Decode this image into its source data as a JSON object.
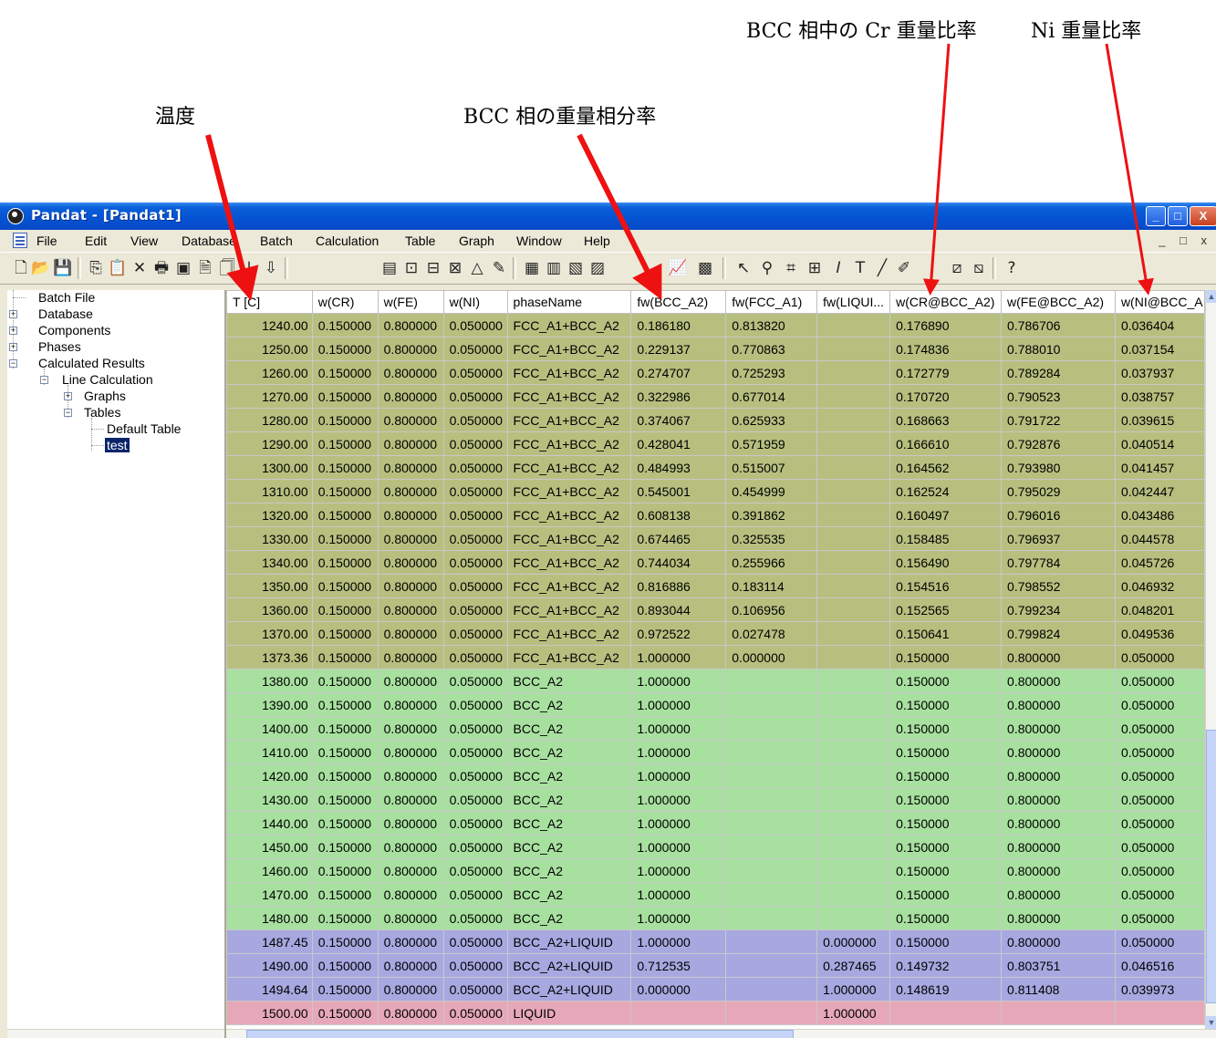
{
  "annotations": {
    "temperature": "温度",
    "bcc_fraction": "BCC 相の重量相分率",
    "cr_in_bcc": "BCC 相中の Cr 重量比率",
    "ni_ratio": "Ni 重量比率",
    "arrow_color": "#ee1111"
  },
  "window": {
    "title": "Pandat - [Pandat1]",
    "controls": {
      "minimize": "_",
      "maximize": "□",
      "close": "X"
    }
  },
  "menubar": {
    "items": [
      "File",
      "Edit",
      "View",
      "Database",
      "Batch",
      "Calculation",
      "Table",
      "Graph",
      "Window",
      "Help"
    ],
    "mdi_controls": "_ □ x"
  },
  "toolbar": {
    "icons": [
      "new-icon",
      "open-icon",
      "save-icon",
      "copy-icon",
      "paste-icon",
      "delete-icon",
      "print-icon",
      "batch-icon",
      "page-icon",
      "page-icon-2",
      "arrow-down-icon",
      "import-icon",
      "table-icon",
      "point-icon",
      "line-icon",
      "envelope-icon",
      "triangle-icon",
      "paint-icon",
      "grid-icon",
      "calc-table-icon",
      "chart-table-icon",
      "chart-table-icon-2",
      "line-chart-icon",
      "excel-icon",
      "pointer-icon",
      "pick-icon",
      "zoom-icon",
      "grid-select-icon",
      "italic-text-icon",
      "text-icon",
      "draw-line-icon",
      "pen-icon",
      "chart-zoom-icon",
      "chart-zoom-icon-2",
      "help-icon"
    ]
  },
  "tree": {
    "batch_file": "Batch File",
    "database": "Database",
    "components": "Components",
    "phases": "Phases",
    "calculated_results": "Calculated Results",
    "line_calculation": "Line Calculation",
    "graphs": "Graphs",
    "tables": "Tables",
    "default_table": "Default Table",
    "test": "test",
    "collapsed_sign": "+",
    "expanded_sign": "−"
  },
  "grid": {
    "columns": [
      "T [C]",
      "w(CR)",
      "w(FE)",
      "w(NI)",
      "phaseName",
      "fw(BCC_A2)",
      "fw(FCC_A1)",
      "fw(LIQUI...",
      "w(CR@BCC_A2)",
      "w(FE@BCC_A2)",
      "w(NI@BCC_A"
    ],
    "phase_colors": {
      "FCC_A1+BCC_A2": "#b7bf7f",
      "BCC_A2": "#a8e0a0",
      "BCC_A2+LIQUID": "#a7a8e0",
      "LIQUID": "#e6a8b8"
    },
    "rows": [
      [
        "1240.00",
        "0.150000",
        "0.800000",
        "0.050000",
        "FCC_A1+BCC_A2",
        "0.186180",
        "0.813820",
        "",
        "0.176890",
        "0.786706",
        "0.036404"
      ],
      [
        "1250.00",
        "0.150000",
        "0.800000",
        "0.050000",
        "FCC_A1+BCC_A2",
        "0.229137",
        "0.770863",
        "",
        "0.174836",
        "0.788010",
        "0.037154"
      ],
      [
        "1260.00",
        "0.150000",
        "0.800000",
        "0.050000",
        "FCC_A1+BCC_A2",
        "0.274707",
        "0.725293",
        "",
        "0.172779",
        "0.789284",
        "0.037937"
      ],
      [
        "1270.00",
        "0.150000",
        "0.800000",
        "0.050000",
        "FCC_A1+BCC_A2",
        "0.322986",
        "0.677014",
        "",
        "0.170720",
        "0.790523",
        "0.038757"
      ],
      [
        "1280.00",
        "0.150000",
        "0.800000",
        "0.050000",
        "FCC_A1+BCC_A2",
        "0.374067",
        "0.625933",
        "",
        "0.168663",
        "0.791722",
        "0.039615"
      ],
      [
        "1290.00",
        "0.150000",
        "0.800000",
        "0.050000",
        "FCC_A1+BCC_A2",
        "0.428041",
        "0.571959",
        "",
        "0.166610",
        "0.792876",
        "0.040514"
      ],
      [
        "1300.00",
        "0.150000",
        "0.800000",
        "0.050000",
        "FCC_A1+BCC_A2",
        "0.484993",
        "0.515007",
        "",
        "0.164562",
        "0.793980",
        "0.041457"
      ],
      [
        "1310.00",
        "0.150000",
        "0.800000",
        "0.050000",
        "FCC_A1+BCC_A2",
        "0.545001",
        "0.454999",
        "",
        "0.162524",
        "0.795029",
        "0.042447"
      ],
      [
        "1320.00",
        "0.150000",
        "0.800000",
        "0.050000",
        "FCC_A1+BCC_A2",
        "0.608138",
        "0.391862",
        "",
        "0.160497",
        "0.796016",
        "0.043486"
      ],
      [
        "1330.00",
        "0.150000",
        "0.800000",
        "0.050000",
        "FCC_A1+BCC_A2",
        "0.674465",
        "0.325535",
        "",
        "0.158485",
        "0.796937",
        "0.044578"
      ],
      [
        "1340.00",
        "0.150000",
        "0.800000",
        "0.050000",
        "FCC_A1+BCC_A2",
        "0.744034",
        "0.255966",
        "",
        "0.156490",
        "0.797784",
        "0.045726"
      ],
      [
        "1350.00",
        "0.150000",
        "0.800000",
        "0.050000",
        "FCC_A1+BCC_A2",
        "0.816886",
        "0.183114",
        "",
        "0.154516",
        "0.798552",
        "0.046932"
      ],
      [
        "1360.00",
        "0.150000",
        "0.800000",
        "0.050000",
        "FCC_A1+BCC_A2",
        "0.893044",
        "0.106956",
        "",
        "0.152565",
        "0.799234",
        "0.048201"
      ],
      [
        "1370.00",
        "0.150000",
        "0.800000",
        "0.050000",
        "FCC_A1+BCC_A2",
        "0.972522",
        "0.027478",
        "",
        "0.150641",
        "0.799824",
        "0.049536"
      ],
      [
        "1373.36",
        "0.150000",
        "0.800000",
        "0.050000",
        "FCC_A1+BCC_A2",
        "1.000000",
        "0.000000",
        "",
        "0.150000",
        "0.800000",
        "0.050000"
      ],
      [
        "1380.00",
        "0.150000",
        "0.800000",
        "0.050000",
        "BCC_A2",
        "1.000000",
        "",
        "",
        "0.150000",
        "0.800000",
        "0.050000"
      ],
      [
        "1390.00",
        "0.150000",
        "0.800000",
        "0.050000",
        "BCC_A2",
        "1.000000",
        "",
        "",
        "0.150000",
        "0.800000",
        "0.050000"
      ],
      [
        "1400.00",
        "0.150000",
        "0.800000",
        "0.050000",
        "BCC_A2",
        "1.000000",
        "",
        "",
        "0.150000",
        "0.800000",
        "0.050000"
      ],
      [
        "1410.00",
        "0.150000",
        "0.800000",
        "0.050000",
        "BCC_A2",
        "1.000000",
        "",
        "",
        "0.150000",
        "0.800000",
        "0.050000"
      ],
      [
        "1420.00",
        "0.150000",
        "0.800000",
        "0.050000",
        "BCC_A2",
        "1.000000",
        "",
        "",
        "0.150000",
        "0.800000",
        "0.050000"
      ],
      [
        "1430.00",
        "0.150000",
        "0.800000",
        "0.050000",
        "BCC_A2",
        "1.000000",
        "",
        "",
        "0.150000",
        "0.800000",
        "0.050000"
      ],
      [
        "1440.00",
        "0.150000",
        "0.800000",
        "0.050000",
        "BCC_A2",
        "1.000000",
        "",
        "",
        "0.150000",
        "0.800000",
        "0.050000"
      ],
      [
        "1450.00",
        "0.150000",
        "0.800000",
        "0.050000",
        "BCC_A2",
        "1.000000",
        "",
        "",
        "0.150000",
        "0.800000",
        "0.050000"
      ],
      [
        "1460.00",
        "0.150000",
        "0.800000",
        "0.050000",
        "BCC_A2",
        "1.000000",
        "",
        "",
        "0.150000",
        "0.800000",
        "0.050000"
      ],
      [
        "1470.00",
        "0.150000",
        "0.800000",
        "0.050000",
        "BCC_A2",
        "1.000000",
        "",
        "",
        "0.150000",
        "0.800000",
        "0.050000"
      ],
      [
        "1480.00",
        "0.150000",
        "0.800000",
        "0.050000",
        "BCC_A2",
        "1.000000",
        "",
        "",
        "0.150000",
        "0.800000",
        "0.050000"
      ],
      [
        "1487.45",
        "0.150000",
        "0.800000",
        "0.050000",
        "BCC_A2+LIQUID",
        "1.000000",
        "",
        "0.000000",
        "0.150000",
        "0.800000",
        "0.050000"
      ],
      [
        "1490.00",
        "0.150000",
        "0.800000",
        "0.050000",
        "BCC_A2+LIQUID",
        "0.712535",
        "",
        "0.287465",
        "0.149732",
        "0.803751",
        "0.046516"
      ],
      [
        "1494.64",
        "0.150000",
        "0.800000",
        "0.050000",
        "BCC_A2+LIQUID",
        "0.000000",
        "",
        "1.000000",
        "0.148619",
        "0.811408",
        "0.039973"
      ],
      [
        "1500.00",
        "0.150000",
        "0.800000",
        "0.050000",
        "LIQUID",
        "",
        "",
        "1.000000",
        "",
        "",
        ""
      ]
    ]
  }
}
